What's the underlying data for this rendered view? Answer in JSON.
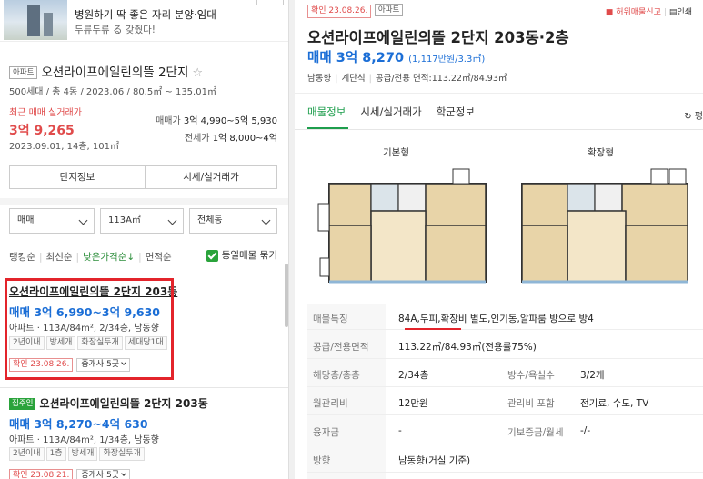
{
  "ad": {
    "title": "병원하기 딱 좋은 자리 분양·임대",
    "subtitle": "두류두류 る 갖췄다!"
  },
  "complex": {
    "tag": "아파트",
    "name": "오션라이프에일린의뜰 2단지",
    "info": "500세대 / 총 4동 / 2023.06 / 80.5㎡ ~ 135.01㎡",
    "recent_label": "최근 매매 실거래가",
    "recent_price": "3억 9,265",
    "recent_date": "2023.09.01, 14층, 101㎡",
    "sale_label": "매매가",
    "sale_value": "3억 4,990~5억 5,930",
    "jeonse_label": "전세가",
    "jeonse_value": "1억 8,000~4억",
    "btn_info": "단지정보",
    "btn_price": "시세/실거래가"
  },
  "filters": {
    "type": "매매",
    "area": "113A㎡",
    "dong": "전체동"
  },
  "sort": {
    "o1": "랭킹순",
    "o2": "최신순",
    "o3": "낮은가격순↓",
    "o4": "면적순",
    "same_label": "동일매물 묶기"
  },
  "listings": [
    {
      "title": "오션라이프에일린의뜰 2단지 203동",
      "price": "매매 3억 6,990~3억 9,630",
      "meta": "아파트 · 113A/84m², 2/34층, 남동향",
      "chips": [
        "2년이내",
        "방세개",
        "화장실두개",
        "세대당1대"
      ],
      "confirm": "확인 23.08.26.",
      "agent": "중개사 5곳"
    },
    {
      "badge": "집주인",
      "title": "오션라이프에일린의뜰 2단지 203동",
      "price": "매매 3억 8,270~4억 630",
      "meta": "아파트 · 113A/84m², 1/34층, 남동향",
      "chips": [
        "2년이내",
        "1층",
        "방세개",
        "화장실두개"
      ],
      "confirm": "확인 23.08.21.",
      "agent": "중개사 5곳"
    }
  ],
  "detail": {
    "confirm": "확인 23.08.26.",
    "tag": "아파트",
    "report": "허위매물신고",
    "print": "인쇄",
    "title": "오션라이프에일린의뜰 2단지 203동·2층",
    "price": "매매 3억 8,270",
    "price_unit": "(1,117만원/3.3㎡)",
    "dir": "남동향",
    "stair": "계단식",
    "area": "공급/전용 면적:113.22㎡/84.93㎡",
    "tabs": [
      "매물정보",
      "시세/실거래가",
      "학군정보"
    ],
    "refresh": "평",
    "fp_basic": "기본형",
    "fp_ext": "확장형",
    "specs": [
      {
        "k": "매물특징",
        "v": "84A,무피,확장비 별도,인기동,알파룸 방으로 방4"
      },
      {
        "k": "공급/전용면적",
        "v": "113.22㎡/84.93㎡(전용률75%)"
      },
      {
        "k": "해당층/총층",
        "v": "2/34층",
        "k2": "방수/욕실수",
        "v2": "3/2개"
      },
      {
        "k": "월관리비",
        "v": "12만원",
        "k2": "관리비 포함",
        "v2": "전기료, 수도, TV"
      },
      {
        "k": "융자금",
        "v": "-",
        "k2": "기보증금/월세",
        "v2": "-/-"
      },
      {
        "k": "방향",
        "v": "남동향(거실 기준)"
      }
    ]
  }
}
